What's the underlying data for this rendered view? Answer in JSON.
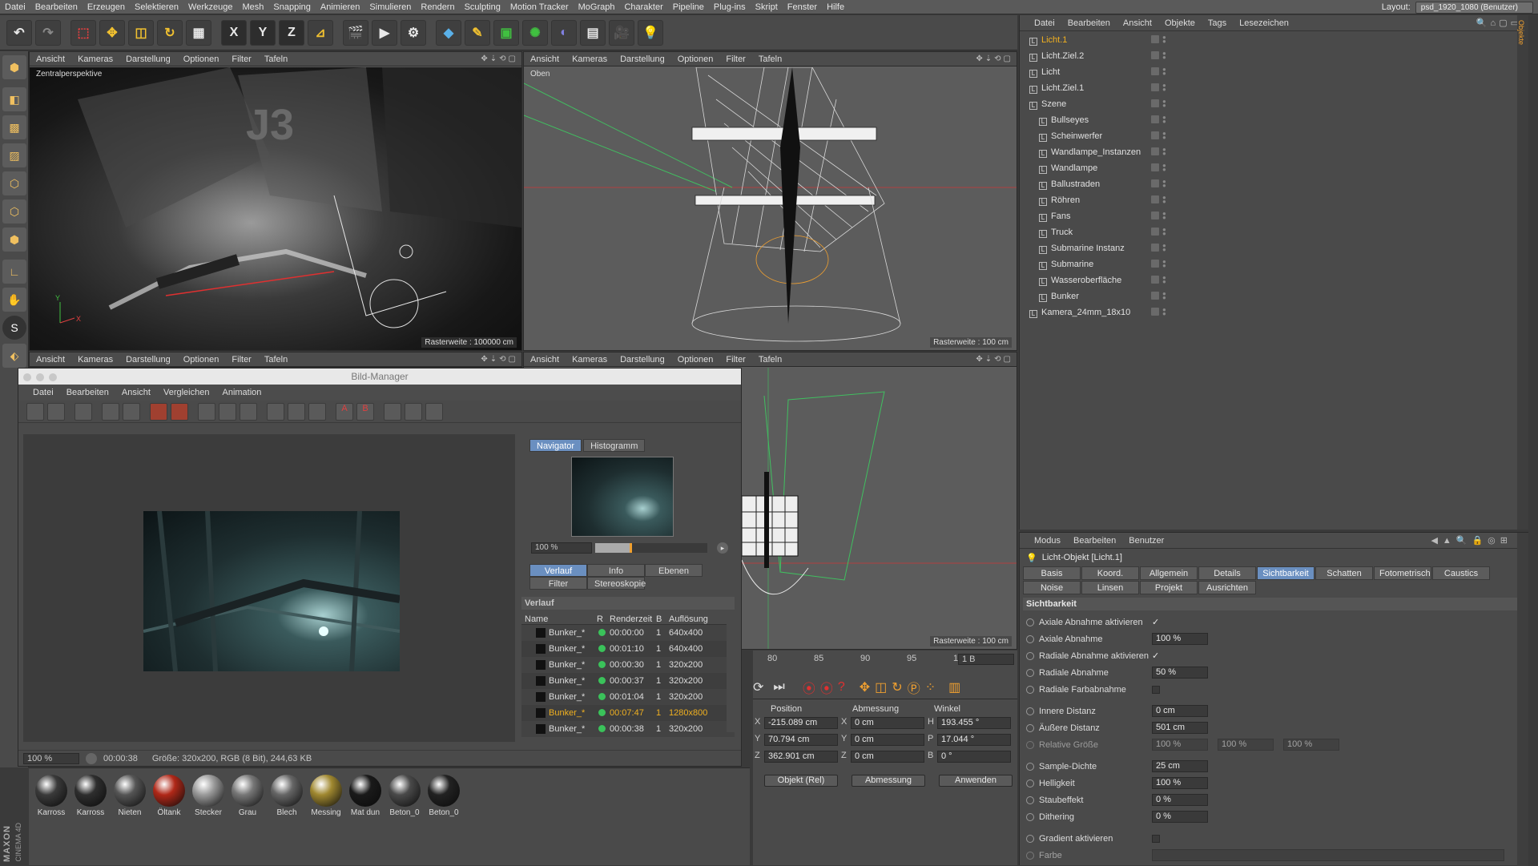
{
  "menubar": {
    "items": [
      "Datei",
      "Bearbeiten",
      "Erzeugen",
      "Selektieren",
      "Werkzeuge",
      "Mesh",
      "Snapping",
      "Animieren",
      "Simulieren",
      "Rendern",
      "Sculpting",
      "Motion Tracker",
      "MoGraph",
      "Charakter",
      "Pipeline",
      "Plug-ins",
      "Skript",
      "Fenster",
      "Hilfe"
    ],
    "layout_label": "Layout:",
    "layout_value": "psd_1920_1080 (Benutzer)"
  },
  "toolbar": {
    "axis_x": "X",
    "axis_y": "Y",
    "axis_z": "Z"
  },
  "viewports": {
    "menu": [
      "Ansicht",
      "Kameras",
      "Darstellung",
      "Optionen",
      "Filter",
      "Tafeln"
    ],
    "vp1_label": "Zentralperspektive",
    "vp1_raster": "Rasterweite : 100000 cm",
    "vp2_label": "Oben",
    "vp2_raster": "Rasterweite : 100 cm",
    "vp4_raster": "Rasterweite : 100 cm",
    "axis_x": "X",
    "axis_y": "Y",
    "axis_z": "Z"
  },
  "object_manager": {
    "menu": [
      "Datei",
      "Bearbeiten",
      "Ansicht",
      "Objekte",
      "Tags",
      "Lesezeichen"
    ],
    "objects": [
      {
        "name": "Licht.1",
        "indent": 0,
        "highlight": true
      },
      {
        "name": "Licht.Ziel.2",
        "indent": 0,
        "highlight": false
      },
      {
        "name": "Licht",
        "indent": 0,
        "highlight": false
      },
      {
        "name": "Licht.Ziel.1",
        "indent": 0,
        "highlight": false
      },
      {
        "name": "Szene",
        "indent": 0,
        "highlight": false
      },
      {
        "name": "Bullseyes",
        "indent": 1,
        "highlight": false
      },
      {
        "name": "Scheinwerfer",
        "indent": 1,
        "highlight": false
      },
      {
        "name": "Wandlampe_Instanzen",
        "indent": 1,
        "highlight": false
      },
      {
        "name": "Wandlampe",
        "indent": 1,
        "highlight": false
      },
      {
        "name": "Ballustraden",
        "indent": 1,
        "highlight": false
      },
      {
        "name": "Röhren",
        "indent": 1,
        "highlight": false
      },
      {
        "name": "Fans",
        "indent": 1,
        "highlight": false
      },
      {
        "name": "Truck",
        "indent": 1,
        "highlight": false
      },
      {
        "name": "Submarine Instanz",
        "indent": 1,
        "highlight": false
      },
      {
        "name": "Submarine",
        "indent": 1,
        "highlight": false
      },
      {
        "name": "Wasseroberfläche",
        "indent": 1,
        "highlight": false
      },
      {
        "name": "Bunker",
        "indent": 1,
        "highlight": false
      },
      {
        "name": "Kamera_24mm_18x10",
        "indent": 0,
        "highlight": false
      }
    ]
  },
  "attribute_manager": {
    "menu": [
      "Modus",
      "Bearbeiten",
      "Benutzer"
    ],
    "title": "Licht-Objekt [Licht.1]",
    "tabs_row1": [
      "Basis",
      "Koord.",
      "Allgemein",
      "Details",
      "Sichtbarkeit",
      "Schatten",
      "Fotometrisch",
      "Caustics"
    ],
    "tabs_row2": [
      "Noise",
      "Linsen",
      "Projekt",
      "Ausrichten"
    ],
    "active_tab": "Sichtbarkeit",
    "section": "Sichtbarkeit",
    "fields": [
      {
        "label": "Axiale Abnahme aktivieren",
        "type": "check",
        "value": "✓"
      },
      {
        "label": "Axiale Abnahme",
        "type": "value",
        "value": "100 %"
      },
      {
        "label": "Radiale Abnahme aktivieren",
        "type": "check",
        "value": "✓"
      },
      {
        "label": "Radiale Abnahme",
        "type": "value",
        "value": "50 %"
      },
      {
        "label": "Radiale Farbabnahme",
        "type": "box",
        "value": ""
      },
      {
        "label": "Innere Distanz",
        "type": "value",
        "value": "0 cm"
      },
      {
        "label": "Äußere Distanz",
        "type": "value",
        "value": "501 cm"
      },
      {
        "label": "Relative Größe",
        "type": "triple",
        "value": "100 %",
        "value2": "100 %",
        "value3": "100 %"
      },
      {
        "label": "Sample-Dichte",
        "type": "value",
        "value": "25 cm"
      },
      {
        "label": "Helligkeit",
        "type": "value",
        "value": "100 %"
      },
      {
        "label": "Staubeffekt",
        "type": "value",
        "value": "0 %"
      },
      {
        "label": "Dithering",
        "type": "value",
        "value": "0 %"
      },
      {
        "label": "Gradient aktivieren",
        "type": "box",
        "value": ""
      },
      {
        "label": "Farbe",
        "type": "gradient",
        "value": ""
      }
    ]
  },
  "bild_manager": {
    "title": "Bild-Manager",
    "menu": [
      "Datei",
      "Bearbeiten",
      "Ansicht",
      "Vergleichen",
      "Animation"
    ],
    "nav_tabs": [
      "Navigator",
      "Histogramm"
    ],
    "zoom": "100 %",
    "info_tabs_row1": [
      "Verlauf",
      "Info",
      "Ebenen"
    ],
    "info_tabs_row2": [
      "Filter",
      "Stereoskopie"
    ],
    "history_title": "Verlauf",
    "columns": [
      "Name",
      "R",
      "Renderzeit",
      "B",
      "Auflösung"
    ],
    "rows": [
      {
        "name": "Bunker_*",
        "time": "00:00:00",
        "b": "1",
        "res": "640x400",
        "sel": false
      },
      {
        "name": "Bunker_*",
        "time": "00:01:10",
        "b": "1",
        "res": "640x400",
        "sel": false
      },
      {
        "name": "Bunker_*",
        "time": "00:00:30",
        "b": "1",
        "res": "320x200",
        "sel": false
      },
      {
        "name": "Bunker_*",
        "time": "00:00:37",
        "b": "1",
        "res": "320x200",
        "sel": false
      },
      {
        "name": "Bunker_*",
        "time": "00:01:04",
        "b": "1",
        "res": "320x200",
        "sel": false
      },
      {
        "name": "Bunker_*",
        "time": "00:07:47",
        "b": "1",
        "res": "1280x800",
        "sel": true
      },
      {
        "name": "Bunker_*",
        "time": "00:00:38",
        "b": "1",
        "res": "320x200",
        "sel": false
      }
    ],
    "status_zoom": "100 %",
    "status_time": "00:00:38",
    "status_info": "Größe: 320x200, RGB (8 Bit), 244,63 KB"
  },
  "timeline": {
    "ticks": [
      "80",
      "85",
      "90",
      "95",
      "10("
    ],
    "frame": "1 B"
  },
  "coords": {
    "headers": [
      "Position",
      "Abmessung",
      "Winkel"
    ],
    "rows": [
      {
        "axis": "X",
        "pos": "-215.089 cm",
        "dim_axis": "X",
        "dim": "0 cm",
        "ang_axis": "H",
        "ang": "193.455 °"
      },
      {
        "axis": "Y",
        "pos": "70.794 cm",
        "dim_axis": "Y",
        "dim": "0 cm",
        "ang_axis": "P",
        "ang": "17.044 °"
      },
      {
        "axis": "Z",
        "pos": "362.901 cm",
        "dim_axis": "Z",
        "dim": "0 cm",
        "ang_axis": "B",
        "ang": "0 °"
      }
    ],
    "mode1": "Objekt (Rel)",
    "mode2": "Abmessung",
    "apply": "Anwenden"
  },
  "materials": [
    {
      "name": "Karross",
      "color": "#3a3a3a"
    },
    {
      "name": "Karross",
      "color": "#2e2e2e"
    },
    {
      "name": "Nieten",
      "color": "#555"
    },
    {
      "name": "Öltank",
      "color": "#b02818"
    },
    {
      "name": "Stecker",
      "color": "#9a9a9a"
    },
    {
      "name": "Grau",
      "color": "#777"
    },
    {
      "name": "Blech",
      "color": "#666"
    },
    {
      "name": "Messing",
      "color": "#a08830"
    },
    {
      "name": "Mat dun",
      "color": "#1a1a1a"
    },
    {
      "name": "Beton_0",
      "color": "#4a4a4a"
    },
    {
      "name": "Beton_0",
      "color": "#222"
    }
  ],
  "brand": {
    "line1": "MAXON",
    "line2": "CINEMA 4D"
  }
}
